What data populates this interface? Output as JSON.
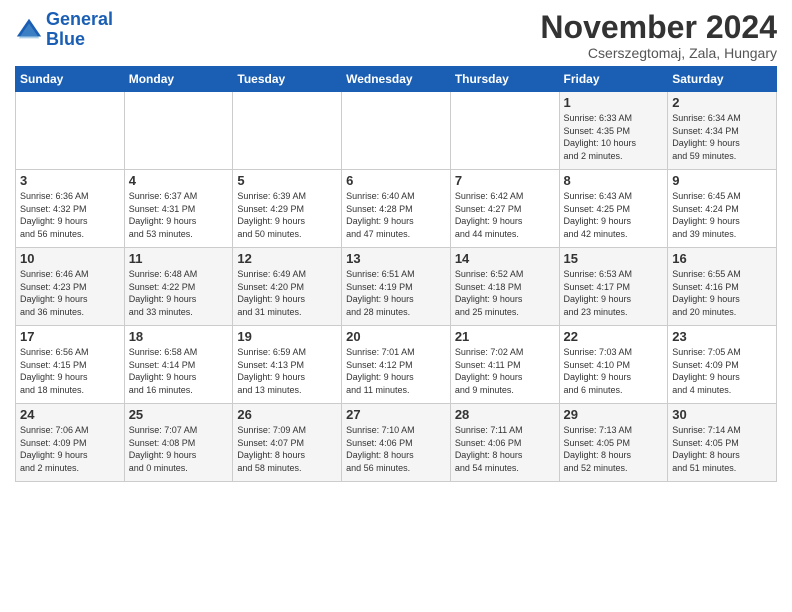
{
  "logo": {
    "line1": "General",
    "line2": "Blue"
  },
  "title": "November 2024",
  "subtitle": "Cserszegtomaj, Zala, Hungary",
  "days_of_week": [
    "Sunday",
    "Monday",
    "Tuesday",
    "Wednesday",
    "Thursday",
    "Friday",
    "Saturday"
  ],
  "weeks": [
    [
      {
        "day": "",
        "info": ""
      },
      {
        "day": "",
        "info": ""
      },
      {
        "day": "",
        "info": ""
      },
      {
        "day": "",
        "info": ""
      },
      {
        "day": "",
        "info": ""
      },
      {
        "day": "1",
        "info": "Sunrise: 6:33 AM\nSunset: 4:35 PM\nDaylight: 10 hours\nand 2 minutes."
      },
      {
        "day": "2",
        "info": "Sunrise: 6:34 AM\nSunset: 4:34 PM\nDaylight: 9 hours\nand 59 minutes."
      }
    ],
    [
      {
        "day": "3",
        "info": "Sunrise: 6:36 AM\nSunset: 4:32 PM\nDaylight: 9 hours\nand 56 minutes."
      },
      {
        "day": "4",
        "info": "Sunrise: 6:37 AM\nSunset: 4:31 PM\nDaylight: 9 hours\nand 53 minutes."
      },
      {
        "day": "5",
        "info": "Sunrise: 6:39 AM\nSunset: 4:29 PM\nDaylight: 9 hours\nand 50 minutes."
      },
      {
        "day": "6",
        "info": "Sunrise: 6:40 AM\nSunset: 4:28 PM\nDaylight: 9 hours\nand 47 minutes."
      },
      {
        "day": "7",
        "info": "Sunrise: 6:42 AM\nSunset: 4:27 PM\nDaylight: 9 hours\nand 44 minutes."
      },
      {
        "day": "8",
        "info": "Sunrise: 6:43 AM\nSunset: 4:25 PM\nDaylight: 9 hours\nand 42 minutes."
      },
      {
        "day": "9",
        "info": "Sunrise: 6:45 AM\nSunset: 4:24 PM\nDaylight: 9 hours\nand 39 minutes."
      }
    ],
    [
      {
        "day": "10",
        "info": "Sunrise: 6:46 AM\nSunset: 4:23 PM\nDaylight: 9 hours\nand 36 minutes."
      },
      {
        "day": "11",
        "info": "Sunrise: 6:48 AM\nSunset: 4:22 PM\nDaylight: 9 hours\nand 33 minutes."
      },
      {
        "day": "12",
        "info": "Sunrise: 6:49 AM\nSunset: 4:20 PM\nDaylight: 9 hours\nand 31 minutes."
      },
      {
        "day": "13",
        "info": "Sunrise: 6:51 AM\nSunset: 4:19 PM\nDaylight: 9 hours\nand 28 minutes."
      },
      {
        "day": "14",
        "info": "Sunrise: 6:52 AM\nSunset: 4:18 PM\nDaylight: 9 hours\nand 25 minutes."
      },
      {
        "day": "15",
        "info": "Sunrise: 6:53 AM\nSunset: 4:17 PM\nDaylight: 9 hours\nand 23 minutes."
      },
      {
        "day": "16",
        "info": "Sunrise: 6:55 AM\nSunset: 4:16 PM\nDaylight: 9 hours\nand 20 minutes."
      }
    ],
    [
      {
        "day": "17",
        "info": "Sunrise: 6:56 AM\nSunset: 4:15 PM\nDaylight: 9 hours\nand 18 minutes."
      },
      {
        "day": "18",
        "info": "Sunrise: 6:58 AM\nSunset: 4:14 PM\nDaylight: 9 hours\nand 16 minutes."
      },
      {
        "day": "19",
        "info": "Sunrise: 6:59 AM\nSunset: 4:13 PM\nDaylight: 9 hours\nand 13 minutes."
      },
      {
        "day": "20",
        "info": "Sunrise: 7:01 AM\nSunset: 4:12 PM\nDaylight: 9 hours\nand 11 minutes."
      },
      {
        "day": "21",
        "info": "Sunrise: 7:02 AM\nSunset: 4:11 PM\nDaylight: 9 hours\nand 9 minutes."
      },
      {
        "day": "22",
        "info": "Sunrise: 7:03 AM\nSunset: 4:10 PM\nDaylight: 9 hours\nand 6 minutes."
      },
      {
        "day": "23",
        "info": "Sunrise: 7:05 AM\nSunset: 4:09 PM\nDaylight: 9 hours\nand 4 minutes."
      }
    ],
    [
      {
        "day": "24",
        "info": "Sunrise: 7:06 AM\nSunset: 4:09 PM\nDaylight: 9 hours\nand 2 minutes."
      },
      {
        "day": "25",
        "info": "Sunrise: 7:07 AM\nSunset: 4:08 PM\nDaylight: 9 hours\nand 0 minutes."
      },
      {
        "day": "26",
        "info": "Sunrise: 7:09 AM\nSunset: 4:07 PM\nDaylight: 8 hours\nand 58 minutes."
      },
      {
        "day": "27",
        "info": "Sunrise: 7:10 AM\nSunset: 4:06 PM\nDaylight: 8 hours\nand 56 minutes."
      },
      {
        "day": "28",
        "info": "Sunrise: 7:11 AM\nSunset: 4:06 PM\nDaylight: 8 hours\nand 54 minutes."
      },
      {
        "day": "29",
        "info": "Sunrise: 7:13 AM\nSunset: 4:05 PM\nDaylight: 8 hours\nand 52 minutes."
      },
      {
        "day": "30",
        "info": "Sunrise: 7:14 AM\nSunset: 4:05 PM\nDaylight: 8 hours\nand 51 minutes."
      }
    ]
  ]
}
